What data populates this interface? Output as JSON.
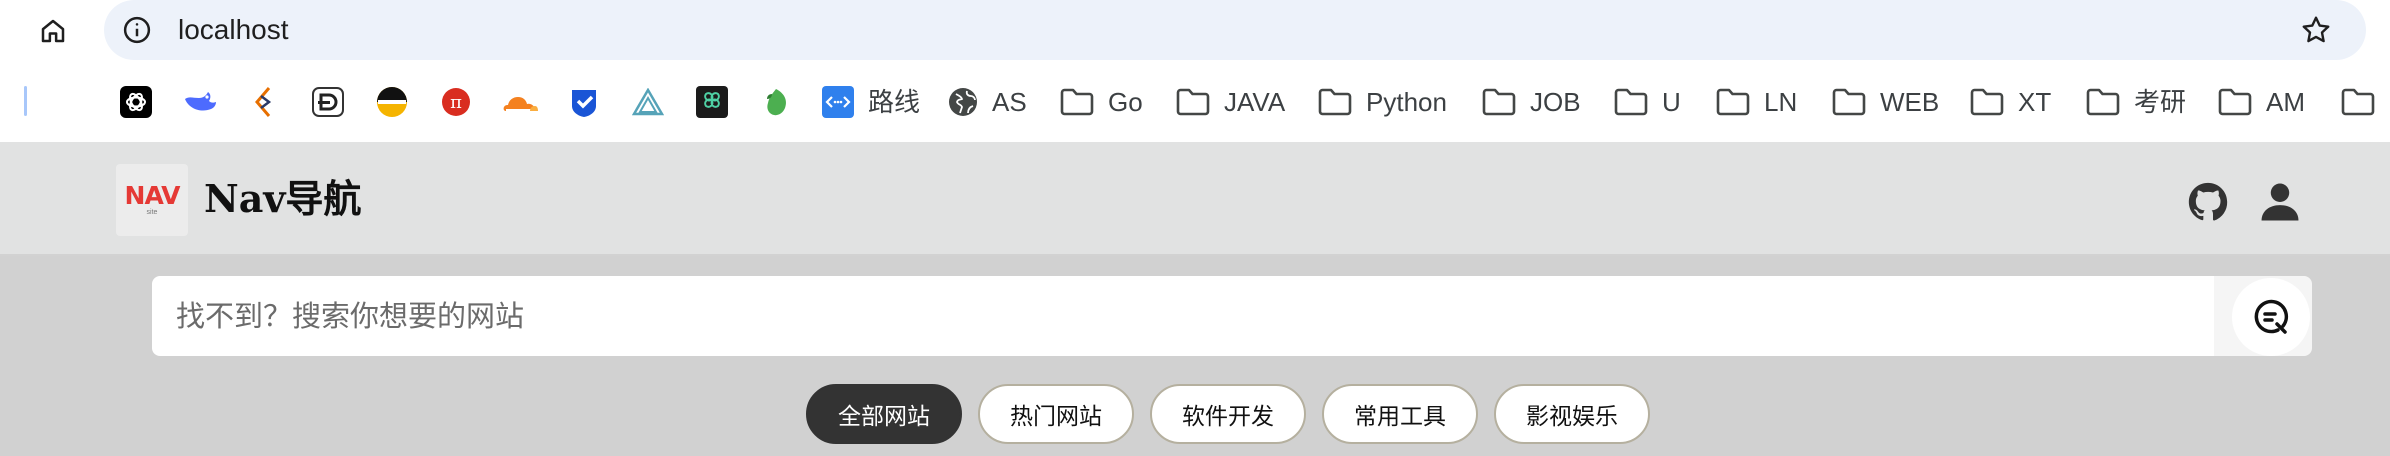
{
  "browser": {
    "url": "localhost",
    "icons": {
      "home": "home-icon",
      "site_info": "info-circle-icon",
      "bookmark_star": "star-outline-icon"
    },
    "bookmarks_bar": {
      "site_icons": [
        "openai-icon",
        "deepseek-icon",
        "java-icon",
        "editor-icon",
        "penguin-icon",
        "pi-icon",
        "cloudflare-icon",
        "check-icon",
        "triangle-icon",
        "grid-icon",
        "leaf-icon"
      ],
      "items": [
        {
          "label": "路线",
          "icon": "code-badge-icon"
        },
        {
          "label": "AS",
          "icon": "globe-icon"
        },
        {
          "label": "Go",
          "icon": "folder-icon"
        },
        {
          "label": "JAVA",
          "icon": "folder-icon"
        },
        {
          "label": "Python",
          "icon": "folder-icon"
        },
        {
          "label": "JOB",
          "icon": "folder-icon"
        },
        {
          "label": "U",
          "icon": "folder-icon"
        },
        {
          "label": "LN",
          "icon": "folder-icon"
        },
        {
          "label": "WEB",
          "icon": "folder-icon"
        },
        {
          "label": "XT",
          "icon": "folder-icon"
        },
        {
          "label": "考研",
          "icon": "folder-icon"
        },
        {
          "label": "AM",
          "icon": "folder-icon"
        }
      ]
    }
  },
  "header": {
    "logo_text": "NAV",
    "logo_subtext": "site",
    "title": "Nav导航",
    "icons": {
      "github": "github-icon",
      "user": "user-icon"
    }
  },
  "search": {
    "placeholder": "找不到？搜索你想要的网站",
    "icon": "search-icon"
  },
  "tabs": [
    {
      "label": "全部网站",
      "active": true
    },
    {
      "label": "热门网站",
      "active": false
    },
    {
      "label": "软件开发",
      "active": false
    },
    {
      "label": "常用工具",
      "active": false
    },
    {
      "label": "影视娱乐",
      "active": false
    }
  ],
  "colors": {
    "omnibox_bg": "#edf2fa",
    "header_bg": "#e1e2e2",
    "main_bg": "#d1d1d1",
    "tab_active_bg": "#333333",
    "tab_border": "#b5b09f"
  }
}
